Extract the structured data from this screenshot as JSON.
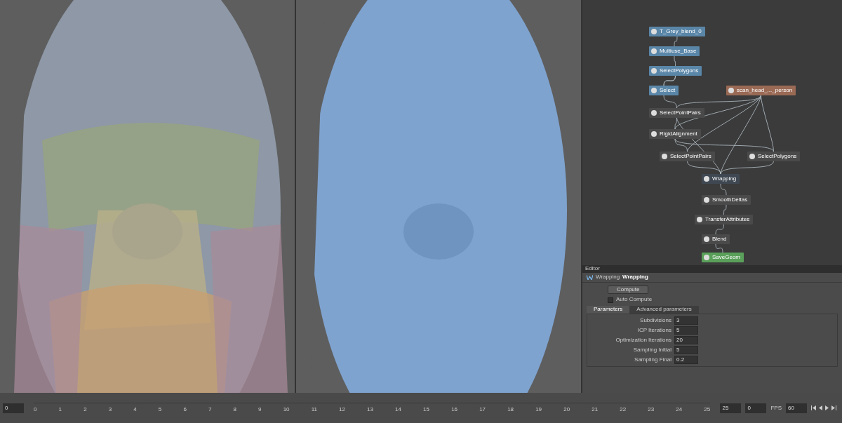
{
  "graph": {
    "nodes": [
      {
        "label": "T_Grey_blend_0",
        "color": "#5a86a8"
      },
      {
        "label": "Multiuse_Base",
        "color": "#5a86a8"
      },
      {
        "label": "SelectPolygons",
        "color": "#5a86a8"
      },
      {
        "label": "Select",
        "color": "#5a86a8"
      },
      {
        "label": "scan_head_..._person",
        "color": "#9a6a55"
      },
      {
        "label": "SelectPointPairs",
        "color": "#4a4a4a"
      },
      {
        "label": "RigidAlignment",
        "color": "#4a4a4a"
      },
      {
        "label": "SelectPointPairs",
        "color": "#4a4a4a"
      },
      {
        "label": "SelectPolygons",
        "color": "#4a4a4a"
      },
      {
        "label": "Wrapping",
        "color": "#3f4852"
      },
      {
        "label": "SmoothDeltas",
        "color": "#4a4a4a"
      },
      {
        "label": "TransferAttributes",
        "color": "#4a4a4a"
      },
      {
        "label": "Blend",
        "color": "#4a4a4a"
      },
      {
        "label": "SaveGeom",
        "color": "#5aa05a"
      }
    ]
  },
  "editor": {
    "title": "Editor",
    "node_type": "Wrapping",
    "node_name": "Wrapping",
    "compute": "Compute",
    "auto_compute": {
      "label": "Auto Compute",
      "checked": false
    },
    "tabs": [
      {
        "label": "Parameters",
        "selected": true
      },
      {
        "label": "Advanced parameters",
        "selected": false
      }
    ],
    "params": [
      {
        "label": "Subdivisions",
        "value": "3"
      },
      {
        "label": "ICP Iterations",
        "value": "5"
      },
      {
        "label": "Optimization Iterations",
        "value": "20"
      },
      {
        "label": "Sampling Initial",
        "value": "5"
      },
      {
        "label": "Sampling Final",
        "value": "0.2"
      }
    ]
  },
  "timeline": {
    "frame": "0",
    "ticks": [
      "0",
      "1",
      "2",
      "3",
      "4",
      "5",
      "6",
      "7",
      "8",
      "9",
      "10",
      "11",
      "12",
      "13",
      "14",
      "15",
      "16",
      "17",
      "18",
      "19",
      "20",
      "21",
      "22",
      "23",
      "24",
      "25"
    ],
    "end_frame": "25",
    "current": "0",
    "fps_label": "FPS",
    "fps": "60"
  }
}
